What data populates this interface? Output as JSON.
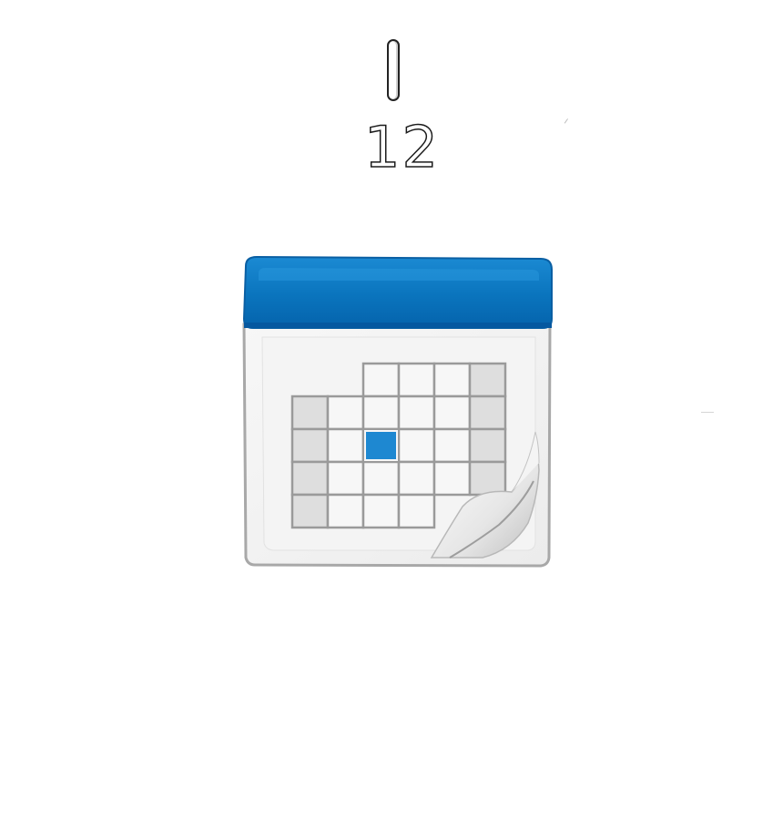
{
  "top_number": "12",
  "colors": {
    "header_blue": "#0a74bd",
    "header_blue_light": "#1b8ad3",
    "header_blue_dark": "#0559a0",
    "highlight_blue": "#1e88d1",
    "page_gray": "#f2f2f2",
    "grid_line": "#9a9a9a",
    "border_gray": "#a8a8a8"
  },
  "icon": {
    "name": "calendar-icon",
    "highlighted_cell": {
      "row": 2,
      "col": 2
    }
  }
}
